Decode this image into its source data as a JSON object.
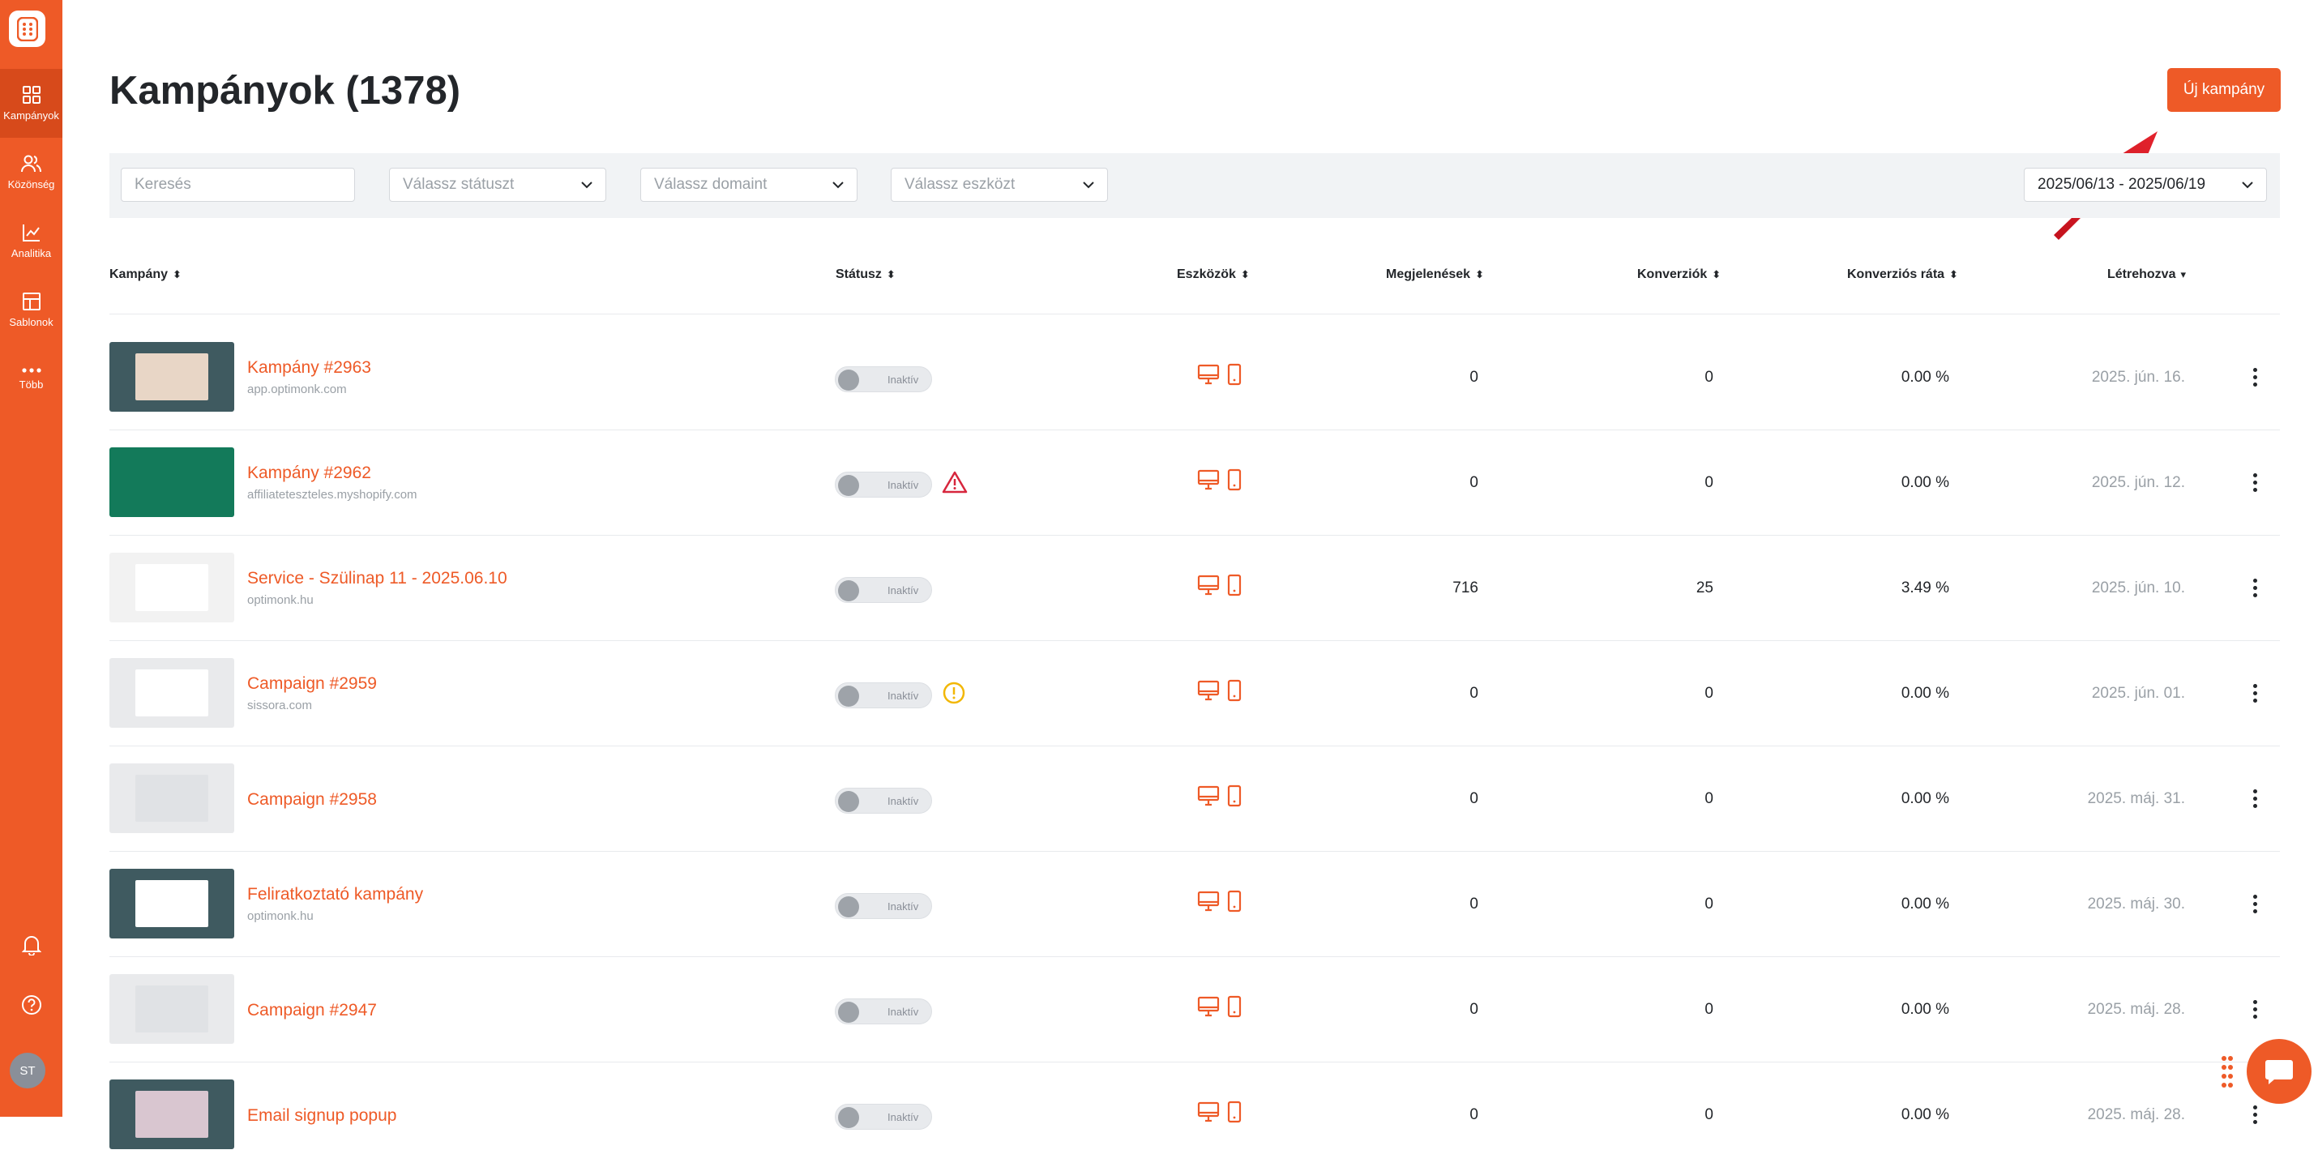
{
  "sidebar": {
    "items": [
      {
        "label": "Kampányok",
        "icon": "grid-icon"
      },
      {
        "label": "Közönség",
        "icon": "users-icon"
      },
      {
        "label": "Analitika",
        "icon": "chart-icon"
      },
      {
        "label": "Sablonok",
        "icon": "template-icon"
      },
      {
        "label": "Több",
        "icon": "more-icon"
      }
    ],
    "avatar": "ST"
  },
  "header": {
    "title": "Kampányok (1378)",
    "new_button": "Új kampány"
  },
  "filters": {
    "search_placeholder": "Keresés",
    "status_placeholder": "Válassz státuszt",
    "domain_placeholder": "Válassz domaint",
    "device_placeholder": "Válassz eszközt",
    "date_range": "2025/06/13 - 2025/06/19"
  },
  "table": {
    "headers": {
      "campaign": "Kampány",
      "status": "Státusz",
      "devices": "Eszközök",
      "impressions": "Megjelenések",
      "conversions": "Konverziók",
      "conversion_rate": "Konverziós ráta",
      "created": "Létrehozva"
    },
    "rows": [
      {
        "name": "Kampány #2963",
        "domain": "app.optimonk.com",
        "status": "Inaktív",
        "impressions": "0",
        "conversions": "0",
        "rate": "0.00 %",
        "created": "2025. jún. 16."
      },
      {
        "name": "Kampány #2962",
        "domain": "affiliateteszteles.myshopify.com",
        "status": "Inaktív",
        "impressions": "0",
        "conversions": "0",
        "rate": "0.00 %",
        "created": "2025. jún. 12."
      },
      {
        "name": "Service - Szülinap 11 - 2025.06.10",
        "domain": "optimonk.hu",
        "status": "Inaktív",
        "impressions": "716",
        "conversions": "25",
        "rate": "3.49 %",
        "created": "2025. jún. 10."
      },
      {
        "name": "Campaign #2959",
        "domain": "sissora.com",
        "status": "Inaktív",
        "impressions": "0",
        "conversions": "0",
        "rate": "0.00 %",
        "created": "2025. jún. 01."
      },
      {
        "name": "Campaign #2958",
        "domain": "",
        "status": "Inaktív",
        "impressions": "0",
        "conversions": "0",
        "rate": "0.00 %",
        "created": "2025. máj. 31."
      },
      {
        "name": "Feliratkoztató kampány",
        "domain": "optimonk.hu",
        "status": "Inaktív",
        "impressions": "0",
        "conversions": "0",
        "rate": "0.00 %",
        "created": "2025. máj. 30."
      },
      {
        "name": "Campaign #2947",
        "domain": "",
        "status": "Inaktív",
        "impressions": "0",
        "conversions": "0",
        "rate": "0.00 %",
        "created": "2025. máj. 28."
      },
      {
        "name": "Email signup popup",
        "domain": "",
        "status": "Inaktív",
        "impressions": "0",
        "conversions": "0",
        "rate": "0.00 %",
        "created": "2025. máj. 28."
      }
    ]
  },
  "colors": {
    "accent": "#ee5a27",
    "danger": "#d7263d",
    "warning": "#f2b705"
  }
}
